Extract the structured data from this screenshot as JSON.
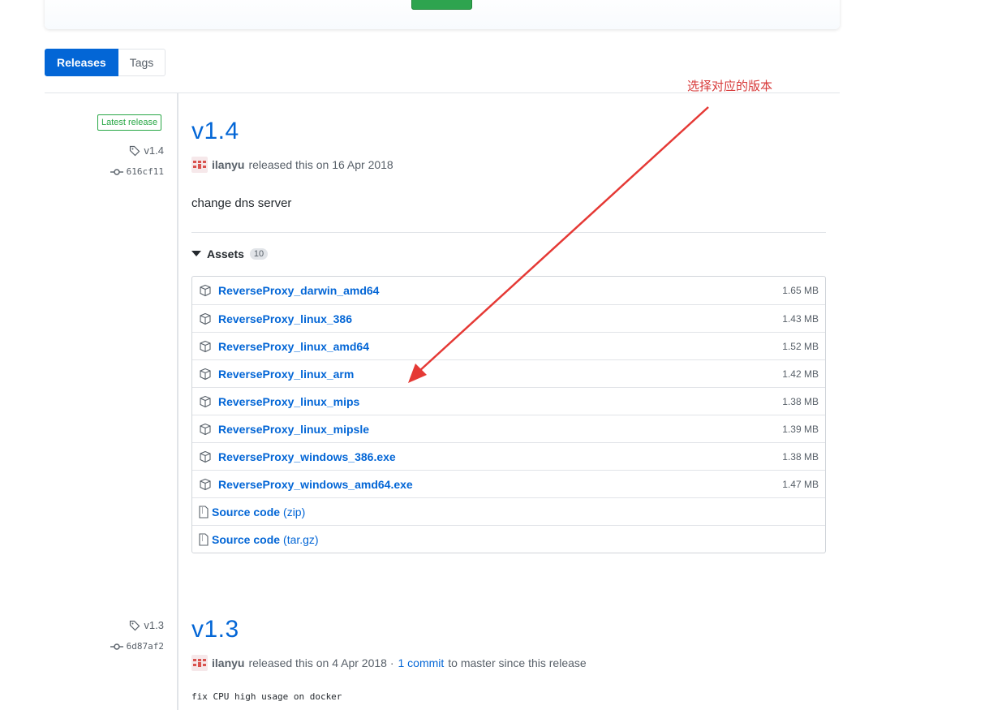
{
  "subnav": {
    "releases_label": "Releases",
    "tags_label": "Tags"
  },
  "annotation": {
    "text": "选择对应的版本",
    "color": "#e53935"
  },
  "colors": {
    "link": "#0366d6",
    "green": "#28a745",
    "muted": "#586069"
  },
  "release1": {
    "latest_label": "Latest release",
    "tag": "v1.4",
    "commit": "616cf11",
    "title": "v1.4",
    "author": "ilanyu",
    "released_text": "released this on 16 Apr 2018",
    "notes": "change dns server",
    "assets_label": "Assets",
    "assets_count": "10",
    "assets": [
      {
        "name": "ReverseProxy_darwin_amd64",
        "size": "1.65 MB"
      },
      {
        "name": "ReverseProxy_linux_386",
        "size": "1.43 MB"
      },
      {
        "name": "ReverseProxy_linux_amd64",
        "size": "1.52 MB"
      },
      {
        "name": "ReverseProxy_linux_arm",
        "size": "1.42 MB"
      },
      {
        "name": "ReverseProxy_linux_mips",
        "size": "1.38 MB"
      },
      {
        "name": "ReverseProxy_linux_mipsle",
        "size": "1.39 MB"
      },
      {
        "name": "ReverseProxy_windows_386.exe",
        "size": "1.38 MB"
      },
      {
        "name": "ReverseProxy_windows_amd64.exe",
        "size": "1.47 MB"
      }
    ],
    "source_zip": {
      "name": "Source code",
      "ext": "(zip)"
    },
    "source_tar": {
      "name": "Source code",
      "ext": "(tar.gz)"
    }
  },
  "release2": {
    "tag": "v1.3",
    "commit": "6d87af2",
    "title": "v1.3",
    "author": "ilanyu",
    "released_text": "released this on 4 Apr 2018 ·",
    "commit_link": "1 commit",
    "after_link": "to master since this release",
    "notes": "fix CPU high usage on docker"
  }
}
